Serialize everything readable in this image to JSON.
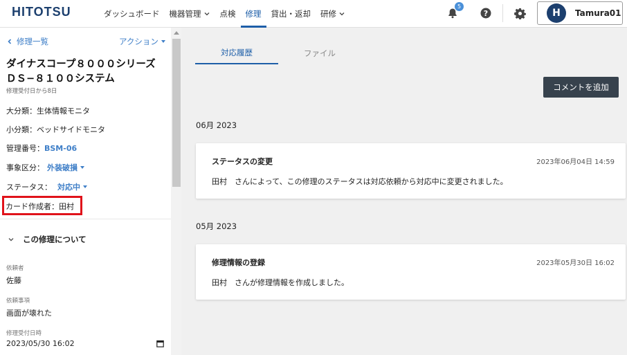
{
  "header": {
    "logo": "HITOTSU",
    "nav": [
      {
        "label": "ダッシュボード",
        "dropdown": false,
        "active": false
      },
      {
        "label": "機器管理",
        "dropdown": true,
        "active": false
      },
      {
        "label": "点検",
        "dropdown": false,
        "active": false
      },
      {
        "label": "修理",
        "dropdown": false,
        "active": true
      },
      {
        "label": "貸出・返却",
        "dropdown": false,
        "active": false
      },
      {
        "label": "研修",
        "dropdown": true,
        "active": false
      }
    ],
    "notification_count": "5",
    "avatar_letter": "H",
    "user_name": "Tamura01",
    "icons": [
      "bell-icon",
      "help-icon",
      "gear-icon"
    ]
  },
  "sidebar": {
    "back_label": "修理一覧",
    "action_label": "アクション",
    "title": "ダイナスコープ８０００シリーズ ＤＳ−８１００システム",
    "subtitle": "修理受付日から8日",
    "fields": {
      "major_category": "大分類：生体情報モニタ",
      "minor_category": "小分類：ベッドサイドモニタ",
      "mgmt_label": "管理番号：",
      "mgmt_value": "BSM-06",
      "event_label": "事象区分：",
      "event_value": "外装破損",
      "status_label": "ステータス：",
      "status_value": "対応中",
      "creator": "カード作成者：田村"
    },
    "section_title": "この修理について",
    "details": {
      "requester_label": "依頼者",
      "requester_value": "佐藤",
      "request_label": "依頼事項",
      "request_value": "画面が壊れた",
      "received_label": "修理受付日時",
      "received_value": "2023/05/30 16:02"
    }
  },
  "main": {
    "tabs": [
      "対応履歴",
      "ファイル"
    ],
    "add_comment_label": "コメントを追加",
    "groups": [
      {
        "month": "06月 2023",
        "card_title": "ステータスの変更",
        "card_time": "2023年06月04日 14:59",
        "card_body": "田村　さんによって、この修理のステータスは対応依頼から対応中に変更されました。"
      },
      {
        "month": "05月 2023",
        "card_title": "修理情報の登録",
        "card_time": "2023年05月30日 16:02",
        "card_body": "田村　さんが修理情報を作成しました。"
      }
    ]
  },
  "colors": {
    "brand": "#1c3f6e",
    "accent": "#1d5ea8",
    "link": "#3f7fc8",
    "highlight": "#e0121a",
    "button_dark": "#37424d"
  }
}
